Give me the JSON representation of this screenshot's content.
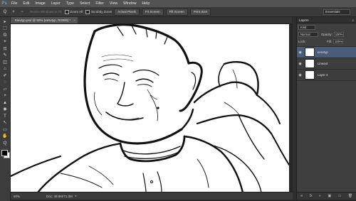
{
  "app": {
    "logo": "Ps"
  },
  "menu": [
    "File",
    "Edit",
    "Image",
    "Layer",
    "Type",
    "Select",
    "Filter",
    "View",
    "Window",
    "Help"
  ],
  "options": {
    "tool_icon": "Q",
    "zoom_in_icon": "+",
    "zoom_out_icon": "−",
    "resize_windows_label": "Resize Windows to Fit",
    "zoom_all_label": "Zoom All",
    "scrubby_label": "Scrubby Zoom",
    "actual_pixels": "Actual Pixels",
    "fit_screen": "Fit Screen",
    "fill_screen": "Fill Screen",
    "print_size": "Print Size",
    "workspace": "Essentials"
  },
  "document": {
    "tab_label": "Kievtyp.psd @ 50% (eesvtyp, RGB/8) *",
    "close": "×"
  },
  "status": {
    "zoom": "50%",
    "doc": "Doc: 49.8M/71.3M"
  },
  "layers_panel": {
    "title": "Layers",
    "menu_icon": "≡",
    "kind_label": "Kind",
    "blend_mode": "Normal",
    "opacity_label": "Opacity:",
    "opacity": "100%",
    "lock_label": "Lock:",
    "fill_label": "Fill:",
    "fill": "100%",
    "layers": [
      {
        "name": "eesvtyp",
        "selected": true
      },
      {
        "name": "Lineout",
        "selected": false
      },
      {
        "name": "Layer 4",
        "selected": false
      }
    ],
    "footer_icons": [
      "∞",
      "fx",
      "◐",
      "▣",
      "▭",
      "🗑"
    ]
  },
  "tools": [
    "▸",
    "⬚",
    "ʘ",
    "⌖",
    "⊡",
    "✎",
    "◫",
    "⌂",
    "✐",
    "◌",
    "▱",
    "◓",
    "▲",
    "◉",
    "T",
    "↖",
    "▭",
    "✋",
    "Q"
  ]
}
